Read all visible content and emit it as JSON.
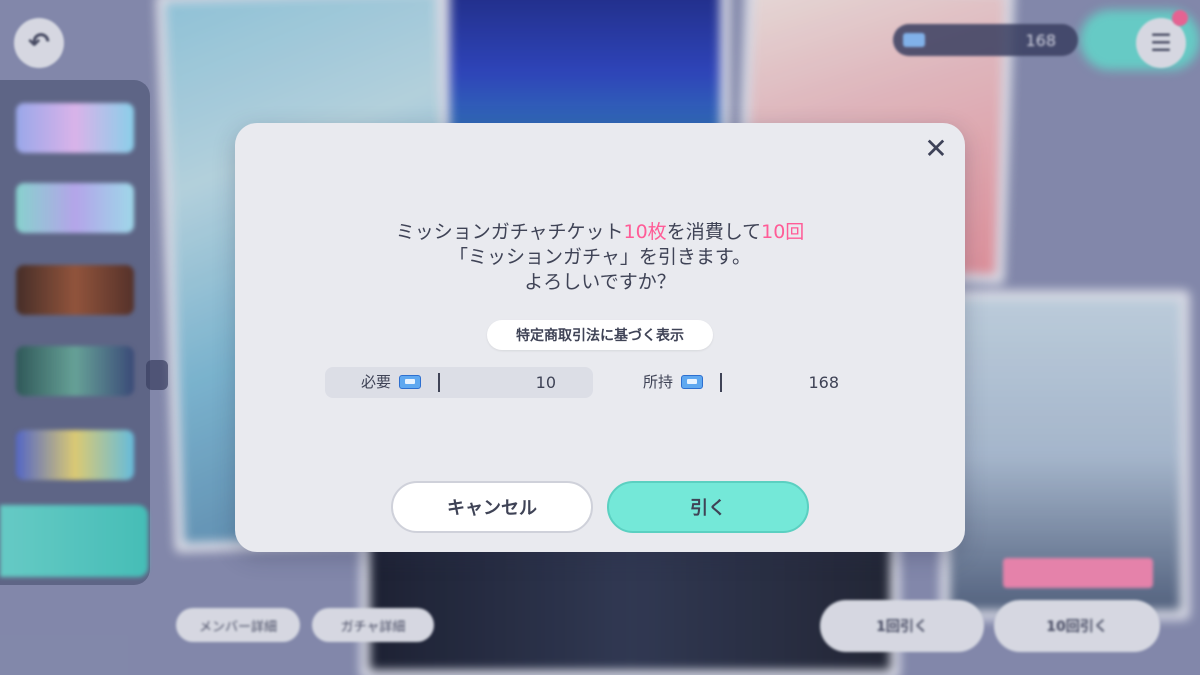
{
  "background": {
    "ticket_count": "168",
    "member_details_label": "メンバー詳細",
    "gacha_details_label": "ガチャ詳細",
    "draw_1_label": "1回引く",
    "draw_10_label": "10回引く",
    "back_icon": "back-arrow-icon",
    "menu_icon": "hamburger-menu-icon"
  },
  "dialog": {
    "message": {
      "line1_prefix": "ミッションガチャチケット",
      "line1_count": "10枚",
      "line1_middle": "を消費して",
      "line1_times": "10回",
      "line2": "「ミッションガチャ」を引きます。",
      "line3": "よろしいですか？"
    },
    "legal_button_label": "特定商取引法に基づく表示",
    "cost": {
      "label": "必要",
      "value": "10"
    },
    "owned": {
      "label": "所持",
      "value": "168"
    },
    "cancel_label": "キャンセル",
    "confirm_label": "引く",
    "close_symbol": "✕",
    "colors": {
      "highlight": "#ff5c97",
      "confirm_button": "#74e8d8",
      "dialog_bg": "#e9eaef"
    }
  }
}
